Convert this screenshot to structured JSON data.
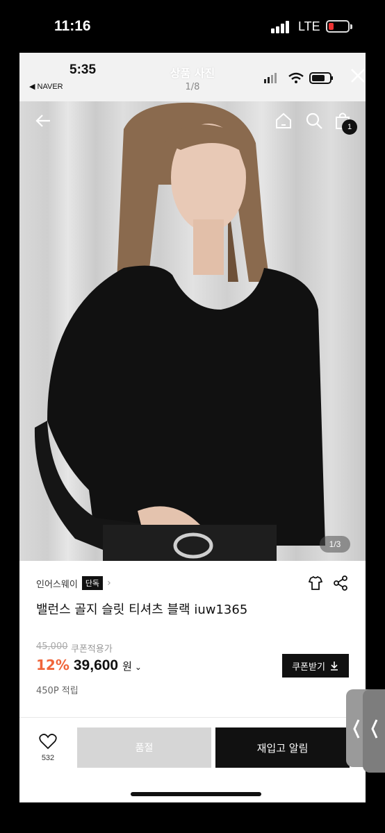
{
  "outer_status": {
    "time": "11:16",
    "network": "LTE",
    "battery_color": "#e33333"
  },
  "inner_status": {
    "time": "5:35",
    "back_app": "◀ NAVER"
  },
  "header": {
    "title": "상품 사진",
    "counter": "1/8"
  },
  "photo": {
    "image_counter": "1/3",
    "cart_badge": "1"
  },
  "product": {
    "brand": "인어스웨이",
    "brand_tag": "단독",
    "title": "밸런스 골지 슬릿 티셔츠 블랙 iuw1365",
    "original_price": "45,000",
    "coupon_note": "쿠폰적용가",
    "discount": "12%",
    "price": "39,600",
    "currency": "원",
    "coupon_button": "쿠폰받기",
    "points": "450P 적립"
  },
  "bottom_bar": {
    "like_count": "532",
    "soldout_label": "품절",
    "restock_label": "재입고 알림"
  },
  "colors": {
    "discount": "#f0653a",
    "primary_button": "#111111",
    "disabled_button": "#d6d6d6"
  }
}
